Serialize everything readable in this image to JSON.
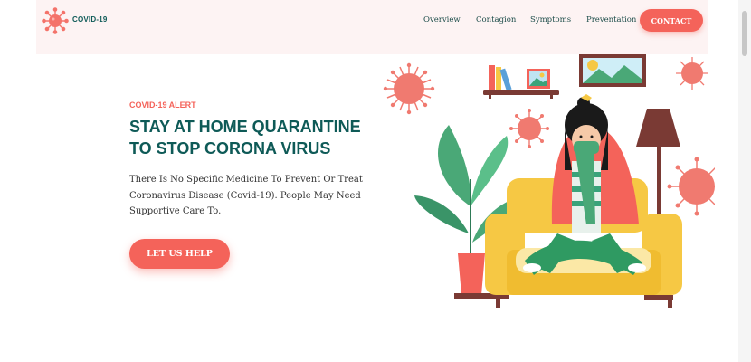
{
  "header": {
    "brand": "COVID-19",
    "nav": [
      "Overview",
      "Contagion",
      "Symptoms",
      "Preventation"
    ],
    "contact_label": "CONTACT"
  },
  "hero": {
    "alert": "COVID-19 ALERT",
    "title_line1": "STAY AT HOME QUARANTINE",
    "title_line2": "TO STOP CORONA VIRUS",
    "description": "There Is No Specific Medicine To Prevent Or Treat Coronavirus Disease (Covid-19). People May Need Supportive Care To.",
    "cta_label": "LET US HELP"
  },
  "colors": {
    "accent": "#f4635a",
    "heading": "#0e5a57",
    "nav_bg": "#fdf3f3"
  },
  "icons": [
    "virus-logo-icon",
    "quarantine-illustration"
  ]
}
